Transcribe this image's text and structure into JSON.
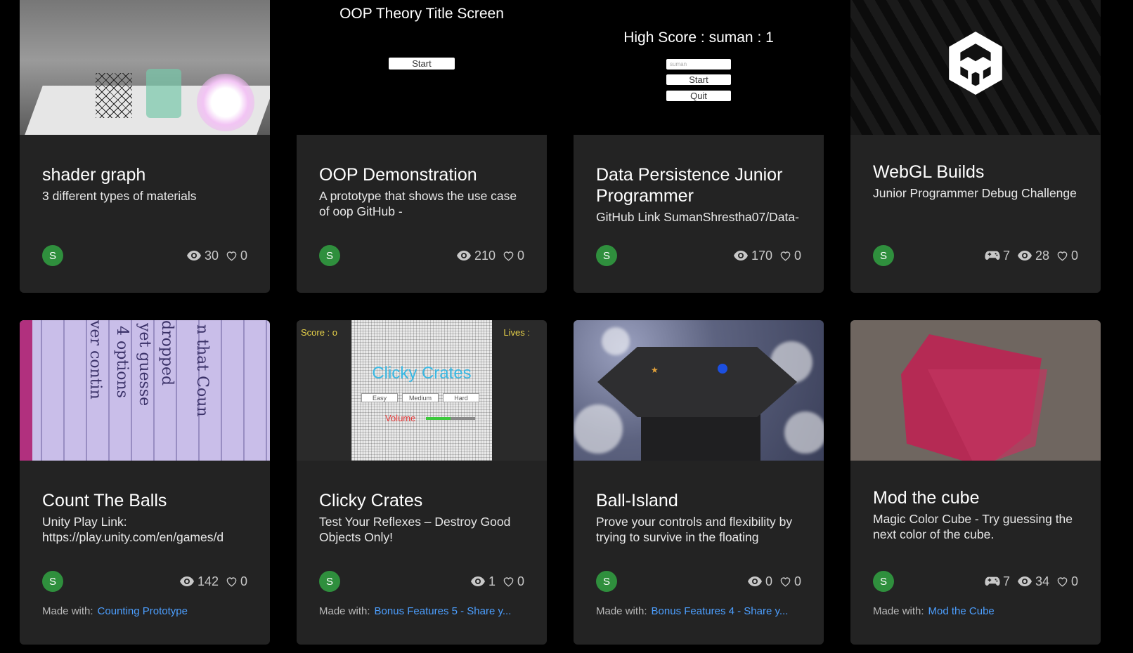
{
  "cards": [
    {
      "title": "shader graph",
      "description": "3 different types of materials",
      "avatar": "S",
      "views": "30",
      "likes": "0"
    },
    {
      "thumbnail": {
        "heading": "OOP Theory Title Screen",
        "button": "Start"
      },
      "title": "OOP Demonstration",
      "description": "A prototype that shows the use case of oop GitHub -",
      "avatar": "S",
      "views": "210",
      "likes": "0"
    },
    {
      "thumbnail": {
        "heading": "High Score : suman : 1",
        "input_value": "suman",
        "start": "Start",
        "quit": "Quit"
      },
      "title": "Data Persistence Junior Programmer",
      "description": "GitHub Link SumanShrestha07/Data-",
      "avatar": "S",
      "views": "170",
      "likes": "0"
    },
    {
      "title": "WebGL Builds",
      "description": "Junior Programmer Debug Challenge",
      "avatar": "S",
      "plays": "7",
      "views": "28",
      "likes": "0"
    },
    {
      "title": "Count The Balls",
      "description": "Unity Play Link: https://play.unity.com/en/games/d",
      "avatar": "S",
      "views": "142",
      "likes": "0",
      "made_with_label": "Made with:",
      "made_with": "Counting Prototype"
    },
    {
      "thumbnail": {
        "score": "Score : o",
        "lives": "Lives :",
        "title": "Clicky Crates",
        "easy": "Easy",
        "medium": "Medium",
        "hard": "Hard",
        "volume": "Volume",
        "volume_level": 0.5
      },
      "title": "Clicky Crates",
      "description": "Test Your Reflexes – Destroy Good Objects Only!",
      "avatar": "S",
      "views": "1",
      "likes": "0",
      "made_with_label": "Made with:",
      "made_with": "Bonus Features 5 - Share y..."
    },
    {
      "title": "Ball-Island",
      "description": "Prove your controls and flexibility by trying to survive in the floating",
      "avatar": "S",
      "views": "0",
      "likes": "0",
      "made_with_label": "Made with:",
      "made_with": "Bonus Features 4 - Share y..."
    },
    {
      "title": "Mod the cube",
      "description": "Magic Color Cube - Try guessing the next color of the cube.",
      "avatar": "S",
      "plays": "7",
      "views": "34",
      "likes": "0",
      "made_with_label": "Made with:",
      "made_with": "Mod the Cube"
    }
  ],
  "colors": {
    "card_bg": "#232323",
    "link": "#4c9fff",
    "avatar": "#2f8f3d",
    "page_bg": "#000000"
  }
}
